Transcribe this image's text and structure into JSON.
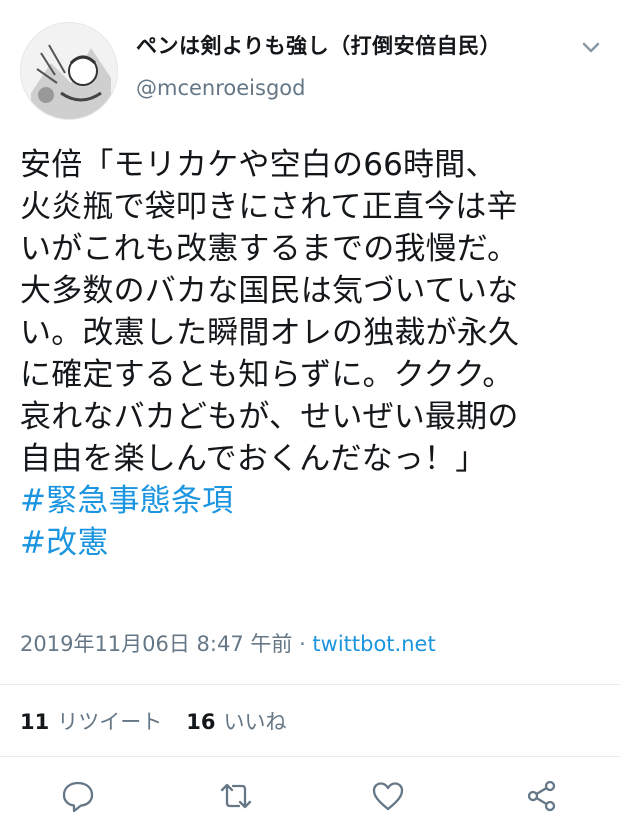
{
  "author": {
    "display_name": "ペンは剣よりも強し（打倒安倍自民）",
    "handle": "@mcenroeisgod",
    "avatar_icon": "manga-avatar-icon"
  },
  "tweet": {
    "lines": [
      "安倍「モリカケや空白の66時間、",
      "火炎瓶で袋叩きにされて正直今は辛",
      "いがこれも改憲するまでの我慢だ。",
      "大多数のバカな国民は気づいていな",
      "い。改憲した瞬間オレの独裁が永久",
      "に確定するとも知らずに。ククク。",
      "哀れなバカどもが、せいぜい最期の",
      "自由を楽しんでおくんだなっ！」"
    ],
    "hashtags": [
      "#緊急事態条項",
      "#改憲"
    ],
    "timestamp": "2019年11月06日 8:47 午前 · ",
    "source": "twittbot.net"
  },
  "stats": {
    "retweets_count": "11",
    "retweets_label": "リツイート",
    "likes_count": "16",
    "likes_label": "いいね"
  },
  "colors": {
    "text": "#14171a",
    "secondary": "#657786",
    "link": "#1b95e0",
    "divider": "#e6ecf0"
  },
  "icons": [
    "reply-icon",
    "retweet-icon",
    "like-icon",
    "share-icon",
    "chevron-down-icon"
  ]
}
